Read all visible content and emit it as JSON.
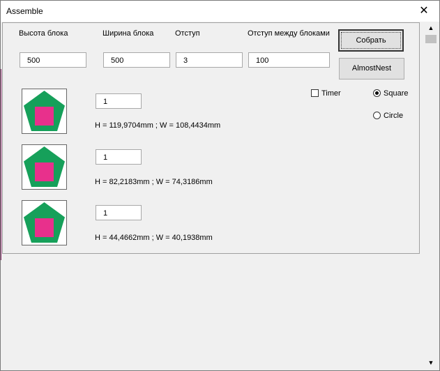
{
  "window": {
    "title": "Assemble",
    "close_glyph": "✕"
  },
  "fields": [
    {
      "label": "Высота блока",
      "value": "500"
    },
    {
      "label": "Ширина блока",
      "value": "500"
    },
    {
      "label": "Отступ",
      "value": "3"
    },
    {
      "label": "Отступ между блоками",
      "value": "100"
    }
  ],
  "buttons": {
    "assemble": "Собрать",
    "almost_nest": "AlmostNest"
  },
  "options": {
    "timer_label": "Timer",
    "timer_checked": false,
    "square_label": "Square",
    "square_selected": true,
    "circle_label": "Circle",
    "circle_selected": false
  },
  "items": [
    {
      "count": "1",
      "dims": "H = 119,9704mm ; W =  108,4434mm"
    },
    {
      "count": "1",
      "dims": "H = 82,2183mm ; W =  74,3186mm"
    },
    {
      "count": "1",
      "dims": "H = 44,4662mm ; W =  40,1938mm"
    }
  ],
  "colors": {
    "pentagon": "#16a05a",
    "square": "#e8308c"
  },
  "icons": {
    "thumbnail": "pentagon-with-square-icon",
    "scroll_up": "▲",
    "scroll_down": "▼"
  }
}
